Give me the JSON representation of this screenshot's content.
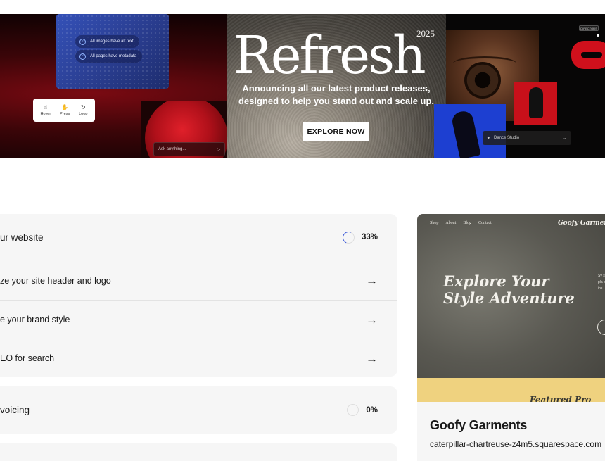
{
  "banner": {
    "title": "Refresh",
    "year": "2025",
    "subtitle_line1": "Announcing all our latest product releases,",
    "subtitle_line2": "designed to help you stand out and scale up.",
    "cta_label": "EXPLORE NOW",
    "checks": [
      "All images have alt text",
      "All pages have metadata"
    ],
    "hover_items": [
      {
        "label": "Hover",
        "icon": "pointer-icon"
      },
      {
        "label": "Press",
        "icon": "press-icon"
      },
      {
        "label": "Loop",
        "icon": "loop-icon"
      }
    ],
    "ask_placeholder": "Ask anything...",
    "dance_label": "Dance Studio",
    "mini_label": "DIRECTORS"
  },
  "checklist": {
    "website": {
      "title": "ur website",
      "progress": "33%",
      "tasks": [
        {
          "label": "ze your site header and logo"
        },
        {
          "label": "e your brand style"
        },
        {
          "label": "EO for search"
        }
      ]
    },
    "invoicing": {
      "title": "voicing",
      "progress": "0%"
    }
  },
  "site": {
    "name": "Goofy Garments",
    "url": "caterpillar-chartreuse-z4m5.squarespace.com",
    "preview": {
      "nav": [
        "Shop",
        "About",
        "Blog",
        "Contact"
      ],
      "brand": "Goofy Garments",
      "hero_line1": "Explore Your",
      "hero_line2": "Style Adventure",
      "side_copy": "Sy st C pla de ins",
      "featured": "Featured Pro"
    }
  },
  "colors": {
    "accent_blue": "#3d5bd9",
    "panel_bg": "#f6f6f6",
    "site_yellow": "#efd27f"
  }
}
